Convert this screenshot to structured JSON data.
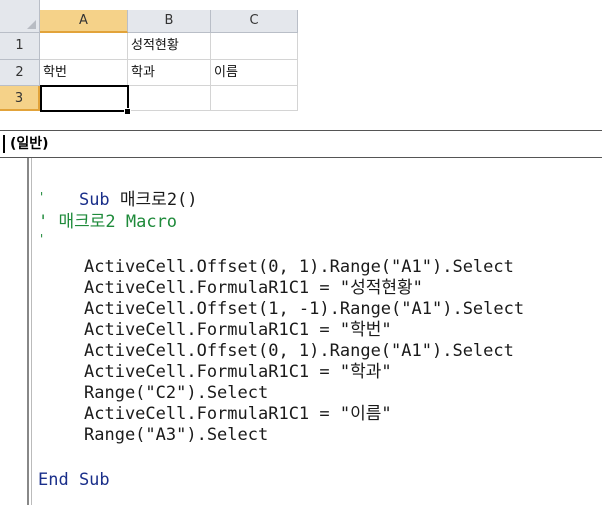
{
  "spreadsheet": {
    "columns": [
      "A",
      "B",
      "C"
    ],
    "rows": [
      "1",
      "2",
      "3"
    ],
    "cells": {
      "B1": "성적현황",
      "A2": "학번",
      "B2": "학과",
      "C2": "이름"
    },
    "active_cell": "A3"
  },
  "formula_bar": {
    "name_box": "(일반)"
  },
  "code": {
    "sub_kw": "Sub",
    "sub_name": " 매크로2()",
    "comment_mark1": "'",
    "comment_text": "' 매크로2 Macro",
    "comment_mark2": "'",
    "lines": [
      "ActiveCell.Offset(0, 1).Range(\"A1\").Select",
      "ActiveCell.FormulaR1C1 = \"성적현황\"",
      "ActiveCell.Offset(1, -1).Range(\"A1\").Select",
      "ActiveCell.FormulaR1C1 = \"학번\"",
      "ActiveCell.Offset(0, 1).Range(\"A1\").Select",
      "ActiveCell.FormulaR1C1 = \"학과\"",
      "Range(\"C2\").Select",
      "ActiveCell.FormulaR1C1 = \"이름\"",
      "Range(\"A3\").Select"
    ],
    "end_sub": "End Sub"
  },
  "colors": {
    "keyword": "#1a2f8a",
    "comment": "#1e8a3a",
    "selected_header": "#f5d289"
  }
}
